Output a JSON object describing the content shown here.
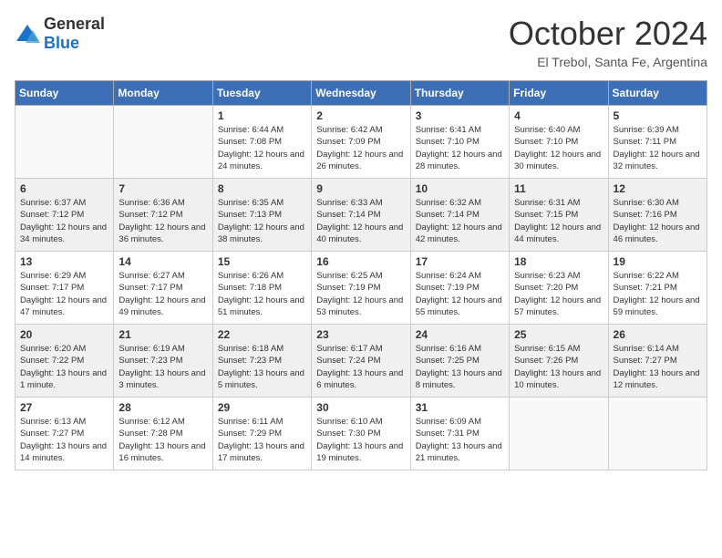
{
  "header": {
    "logo_general": "General",
    "logo_blue": "Blue",
    "title": "October 2024",
    "location": "El Trebol, Santa Fe, Argentina"
  },
  "weekdays": [
    "Sunday",
    "Monday",
    "Tuesday",
    "Wednesday",
    "Thursday",
    "Friday",
    "Saturday"
  ],
  "weeks": [
    [
      {
        "day": "",
        "empty": true
      },
      {
        "day": "",
        "empty": true
      },
      {
        "day": "1",
        "sunrise": "6:44 AM",
        "sunset": "7:08 PM",
        "daylight": "12 hours and 24 minutes."
      },
      {
        "day": "2",
        "sunrise": "6:42 AM",
        "sunset": "7:09 PM",
        "daylight": "12 hours and 26 minutes."
      },
      {
        "day": "3",
        "sunrise": "6:41 AM",
        "sunset": "7:10 PM",
        "daylight": "12 hours and 28 minutes."
      },
      {
        "day": "4",
        "sunrise": "6:40 AM",
        "sunset": "7:10 PM",
        "daylight": "12 hours and 30 minutes."
      },
      {
        "day": "5",
        "sunrise": "6:39 AM",
        "sunset": "7:11 PM",
        "daylight": "12 hours and 32 minutes."
      }
    ],
    [
      {
        "day": "6",
        "sunrise": "6:37 AM",
        "sunset": "7:12 PM",
        "daylight": "12 hours and 34 minutes."
      },
      {
        "day": "7",
        "sunrise": "6:36 AM",
        "sunset": "7:12 PM",
        "daylight": "12 hours and 36 minutes."
      },
      {
        "day": "8",
        "sunrise": "6:35 AM",
        "sunset": "7:13 PM",
        "daylight": "12 hours and 38 minutes."
      },
      {
        "day": "9",
        "sunrise": "6:33 AM",
        "sunset": "7:14 PM",
        "daylight": "12 hours and 40 minutes."
      },
      {
        "day": "10",
        "sunrise": "6:32 AM",
        "sunset": "7:14 PM",
        "daylight": "12 hours and 42 minutes."
      },
      {
        "day": "11",
        "sunrise": "6:31 AM",
        "sunset": "7:15 PM",
        "daylight": "12 hours and 44 minutes."
      },
      {
        "day": "12",
        "sunrise": "6:30 AM",
        "sunset": "7:16 PM",
        "daylight": "12 hours and 46 minutes."
      }
    ],
    [
      {
        "day": "13",
        "sunrise": "6:29 AM",
        "sunset": "7:17 PM",
        "daylight": "12 hours and 47 minutes."
      },
      {
        "day": "14",
        "sunrise": "6:27 AM",
        "sunset": "7:17 PM",
        "daylight": "12 hours and 49 minutes."
      },
      {
        "day": "15",
        "sunrise": "6:26 AM",
        "sunset": "7:18 PM",
        "daylight": "12 hours and 51 minutes."
      },
      {
        "day": "16",
        "sunrise": "6:25 AM",
        "sunset": "7:19 PM",
        "daylight": "12 hours and 53 minutes."
      },
      {
        "day": "17",
        "sunrise": "6:24 AM",
        "sunset": "7:19 PM",
        "daylight": "12 hours and 55 minutes."
      },
      {
        "day": "18",
        "sunrise": "6:23 AM",
        "sunset": "7:20 PM",
        "daylight": "12 hours and 57 minutes."
      },
      {
        "day": "19",
        "sunrise": "6:22 AM",
        "sunset": "7:21 PM",
        "daylight": "12 hours and 59 minutes."
      }
    ],
    [
      {
        "day": "20",
        "sunrise": "6:20 AM",
        "sunset": "7:22 PM",
        "daylight": "13 hours and 1 minute."
      },
      {
        "day": "21",
        "sunrise": "6:19 AM",
        "sunset": "7:23 PM",
        "daylight": "13 hours and 3 minutes."
      },
      {
        "day": "22",
        "sunrise": "6:18 AM",
        "sunset": "7:23 PM",
        "daylight": "13 hours and 5 minutes."
      },
      {
        "day": "23",
        "sunrise": "6:17 AM",
        "sunset": "7:24 PM",
        "daylight": "13 hours and 6 minutes."
      },
      {
        "day": "24",
        "sunrise": "6:16 AM",
        "sunset": "7:25 PM",
        "daylight": "13 hours and 8 minutes."
      },
      {
        "day": "25",
        "sunrise": "6:15 AM",
        "sunset": "7:26 PM",
        "daylight": "13 hours and 10 minutes."
      },
      {
        "day": "26",
        "sunrise": "6:14 AM",
        "sunset": "7:27 PM",
        "daylight": "13 hours and 12 minutes."
      }
    ],
    [
      {
        "day": "27",
        "sunrise": "6:13 AM",
        "sunset": "7:27 PM",
        "daylight": "13 hours and 14 minutes."
      },
      {
        "day": "28",
        "sunrise": "6:12 AM",
        "sunset": "7:28 PM",
        "daylight": "13 hours and 16 minutes."
      },
      {
        "day": "29",
        "sunrise": "6:11 AM",
        "sunset": "7:29 PM",
        "daylight": "13 hours and 17 minutes."
      },
      {
        "day": "30",
        "sunrise": "6:10 AM",
        "sunset": "7:30 PM",
        "daylight": "13 hours and 19 minutes."
      },
      {
        "day": "31",
        "sunrise": "6:09 AM",
        "sunset": "7:31 PM",
        "daylight": "13 hours and 21 minutes."
      },
      {
        "day": "",
        "empty": true
      },
      {
        "day": "",
        "empty": true
      }
    ]
  ]
}
